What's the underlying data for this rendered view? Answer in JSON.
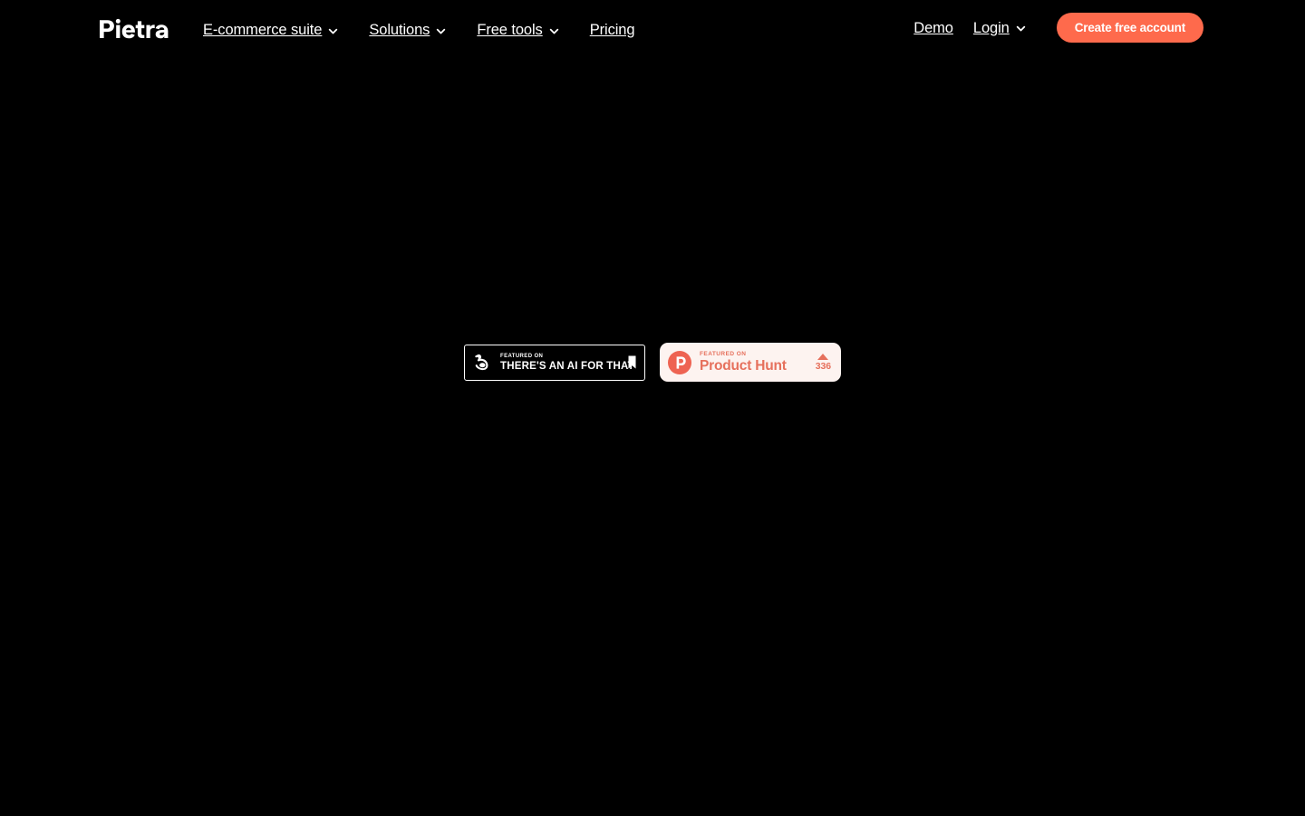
{
  "page": {
    "background_color": "#000000",
    "accent_color": "#fe6a4c"
  },
  "header": {
    "logo": {
      "name": "Pietra",
      "text": "Pietra"
    },
    "primary_nav": [
      {
        "label": "E-commerce suite",
        "has_dropdown": true,
        "icon": "chevron-down-icon"
      },
      {
        "label": "Solutions",
        "has_dropdown": true,
        "icon": "chevron-down-icon"
      },
      {
        "label": "Free tools",
        "has_dropdown": true,
        "icon": "chevron-down-icon"
      },
      {
        "label": "Pricing",
        "has_dropdown": false,
        "icon": ""
      }
    ],
    "secondary_nav": [
      {
        "label": "Demo",
        "has_dropdown": false,
        "icon": ""
      },
      {
        "label": "Login",
        "has_dropdown": true,
        "icon": "chevron-down-icon"
      }
    ],
    "cta": {
      "label": "Create free account",
      "background_color": "#fe6a4c",
      "text_color": "#ffffff"
    }
  },
  "badges": {
    "theres_an_ai_for_that": {
      "icon": "flexed-bicep-icon",
      "featured_label": "FEATURED ON",
      "name": "THERE'S AN AI FOR THAT",
      "trailing_icon": "bookmark-icon",
      "background_color": "#000000",
      "border_color": "#ffffff",
      "text_color": "#ffffff"
    },
    "product_hunt": {
      "icon": "product-hunt-logo-icon",
      "featured_label": "FEATURED ON",
      "name": "Product Hunt",
      "upvote_icon": "upvote-triangle-icon",
      "upvote_count": "336",
      "background_color": "#fdf3f0",
      "text_color": "#e6705c"
    }
  }
}
